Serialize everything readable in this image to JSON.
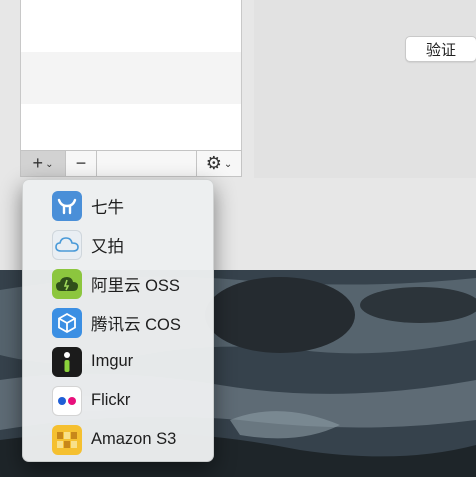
{
  "verify_button": {
    "label": "验证"
  },
  "toolbar": {
    "add_symbol": "+",
    "remove_symbol": "−",
    "chevron": "⌄",
    "gear_symbol": "⚙"
  },
  "menu": {
    "items": [
      {
        "label": "七牛",
        "icon": "qiniu-icon",
        "color": "#4a8fd8"
      },
      {
        "label": "又拍",
        "icon": "upyun-icon",
        "color": "#e9eef3"
      },
      {
        "label": "阿里云 OSS",
        "icon": "aliyun-icon",
        "color": "#8cc63e"
      },
      {
        "label": "腾讯云 COS",
        "icon": "tencent-cloud-icon",
        "color": "#3b8fe3"
      },
      {
        "label": "Imgur",
        "icon": "imgur-icon",
        "color": "#1b1b1b"
      },
      {
        "label": "Flickr",
        "icon": "flickr-icon",
        "color": "#ffffff"
      },
      {
        "label": "Amazon S3",
        "icon": "amazon-s3-icon",
        "color": "#f5c030"
      }
    ]
  }
}
